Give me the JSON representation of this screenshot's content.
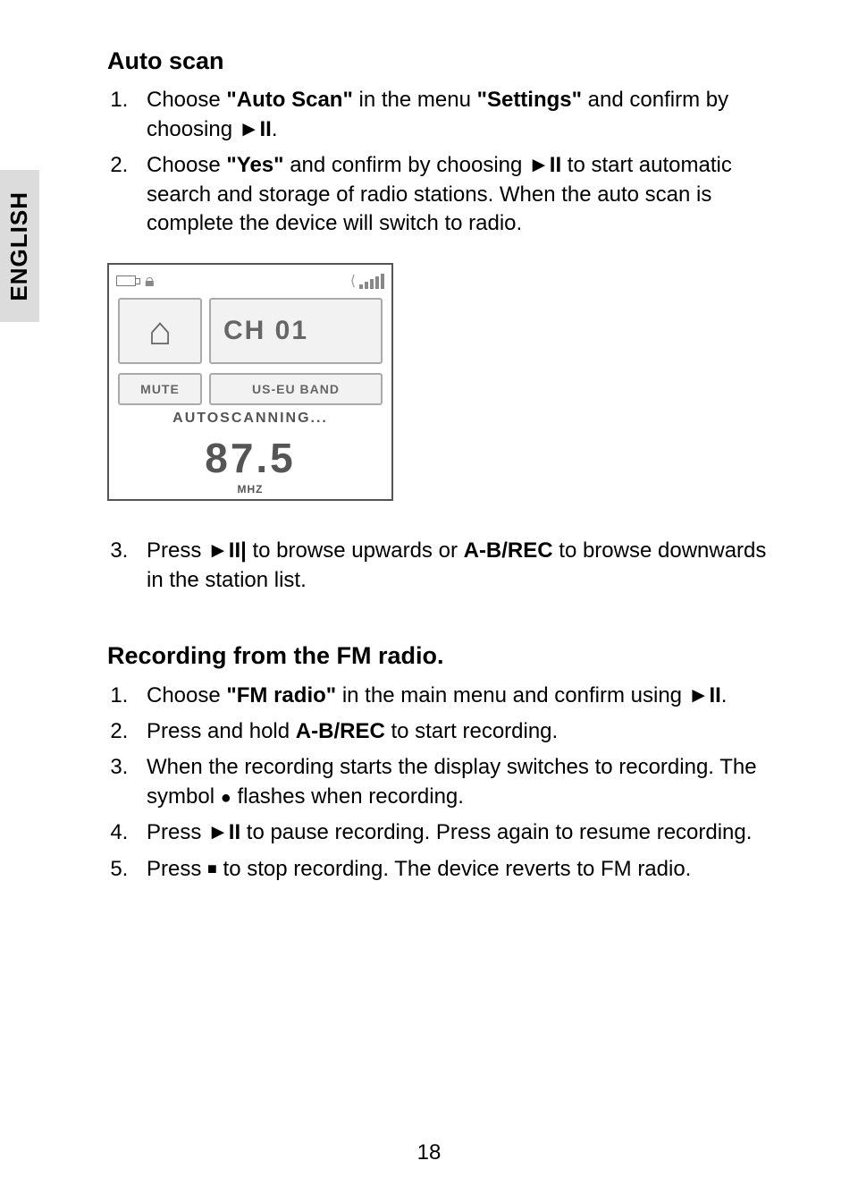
{
  "language_tab": "ENGLISH",
  "page_number": "18",
  "symbols": {
    "play_pause": "►II",
    "play_pause_bar": "►II|",
    "stop": "■",
    "dot": "●"
  },
  "auto_scan": {
    "heading": "Auto scan",
    "steps": {
      "s1_a": "Choose ",
      "s1_b1": "\"Auto Scan\"",
      "s1_c": " in the menu ",
      "s1_b2": "\"Settings\"",
      "s1_d": " and confirm by choosing ",
      "s1_e": ".",
      "s2_a": "Choose ",
      "s2_b": "\"Yes\"",
      "s2_c": " and confirm by choosing ",
      "s2_d": " to start automatic search and storage of radio stations. When the auto scan is complete the device will switch to radio.",
      "s3_a": "Press ",
      "s3_b": " to browse upwards or ",
      "s3_c": "A-B/REC",
      "s3_d": " to browse downwards in the station list."
    }
  },
  "device_screen": {
    "channel": "CH 01",
    "mute": "MUTE",
    "band": "US-EU BAND",
    "autoscanning": "AUTOSCANNING...",
    "freq": "87.5",
    "freq_unit": "MHZ"
  },
  "recording": {
    "heading": "Recording from the FM radio.",
    "steps": {
      "s1_a": "Choose ",
      "s1_b": "\"FM radio\"",
      "s1_c": " in the main menu and confirm using ",
      "s1_d": ".",
      "s2_a": "Press and hold ",
      "s2_b": "A-B/REC",
      "s2_c": " to start recording.",
      "s3_a": "When the recording starts the display switches to recording. The symbol ",
      "s3_b": " flashes when recording.",
      "s4_a": "Press ",
      "s4_b": " to pause recording. Press again to resume recording.",
      "s5_a": "Press ",
      "s5_b": " to stop recording. The device reverts to FM radio."
    }
  }
}
